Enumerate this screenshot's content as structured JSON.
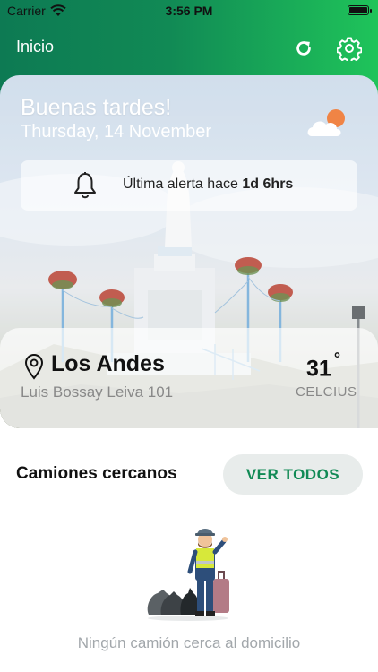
{
  "status_bar": {
    "carrier": "Carrier",
    "time": "3:56 PM"
  },
  "nav": {
    "title": "Inicio",
    "refresh_icon": "refresh-icon",
    "settings_icon": "gear-icon"
  },
  "hero": {
    "greeting": "Buenas tardes!",
    "date": "Thursday, 14 November",
    "weather_icon": "partly-cloudy-icon",
    "alert": {
      "prefix": "Última alerta hace",
      "value": "1d 6hrs",
      "icon": "bell-icon"
    },
    "location": {
      "city": "Los Andes",
      "address": "Luis Bossay Leiva 101",
      "temperature": "31",
      "degree": "°",
      "unit": "CELCIUS",
      "icon": "location-pin-icon"
    }
  },
  "nearby": {
    "title": "Camiones cercanos",
    "view_all": "VER TODOS",
    "empty_message": "Ningún camión cerca al domicilio"
  },
  "colors": {
    "brand_green": "#118a55",
    "gradient_end": "#1fc45a",
    "muted_text": "#a2a7ab"
  }
}
